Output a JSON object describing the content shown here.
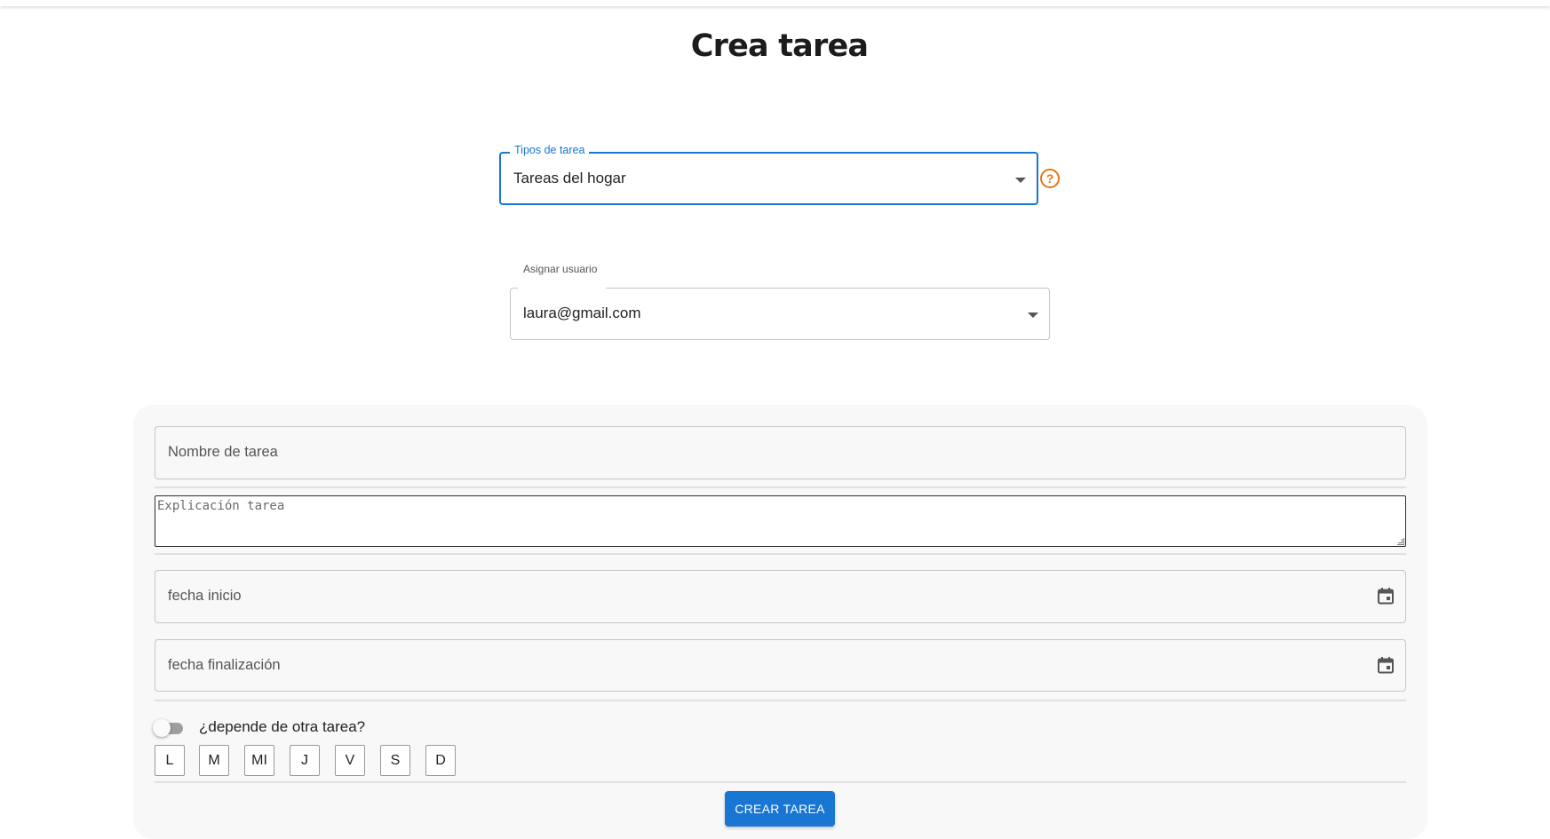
{
  "page": {
    "title": "Crea tarea"
  },
  "task_type": {
    "label": "Tipos de tarea",
    "value": "Tareas del hogar",
    "help_icon": "question-circle-icon"
  },
  "assign_user": {
    "label": "Asignar usuario",
    "value": "laura@gmail.com"
  },
  "form": {
    "name_placeholder": "Nombre de tarea",
    "description_placeholder": "Explicación tarea",
    "start_date_placeholder": "fecha inicio",
    "end_date_placeholder": "fecha finalización",
    "calendar_icon": "calendar-icon",
    "depends_label": "¿depende de otra tarea?",
    "depends_toggle_on": false,
    "days": [
      "L",
      "M",
      "MI",
      "J",
      "V",
      "S",
      "D"
    ],
    "submit_label": "CREAR TAREA"
  },
  "colors": {
    "accent": "#1976d2",
    "help_icon": "#e8770e",
    "card_background": "#f8f8f8"
  }
}
